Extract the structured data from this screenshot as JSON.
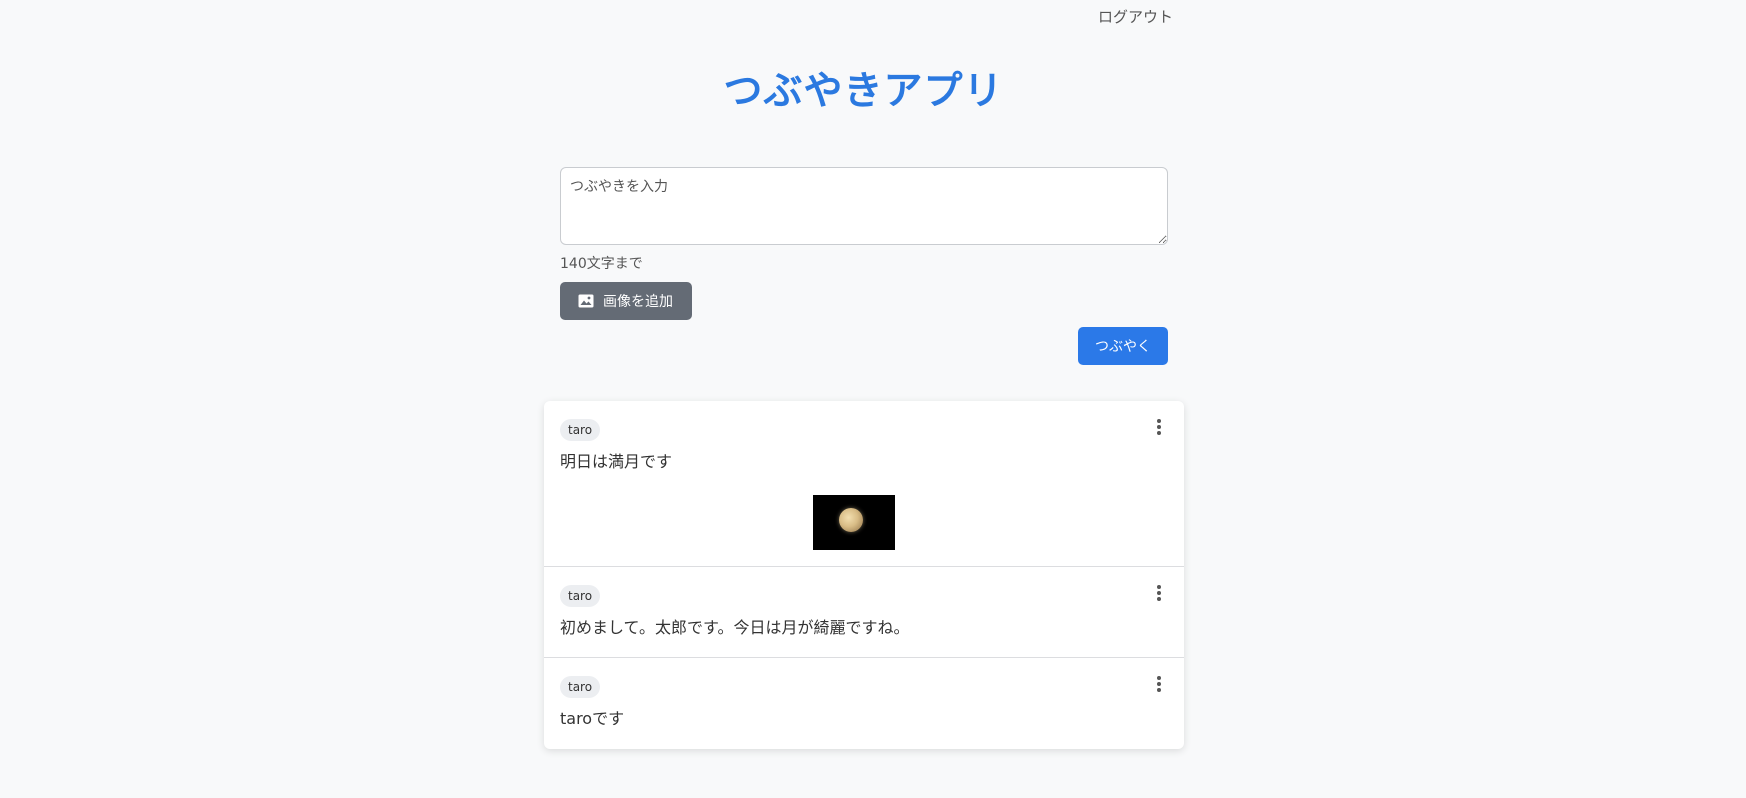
{
  "header": {
    "logout_label": "ログアウト",
    "title": "つぶやきアプリ"
  },
  "composer": {
    "placeholder": "つぶやきを入力",
    "value": "",
    "char_limit_text": "140文字まで",
    "add_image_label": "画像を追加",
    "add_image_icon": "image-icon",
    "submit_label": "つぶやく"
  },
  "colors": {
    "accent": "#2b79e0",
    "secondary_button": "#646b75",
    "background": "#f8f9fa"
  },
  "posts": [
    {
      "user": "taro",
      "text": "明日は満月です",
      "has_image": true,
      "image_subject": "full moon on black background",
      "menu_icon": "more-vertical-icon"
    },
    {
      "user": "taro",
      "text": "初めまして。太郎です。今日は月が綺麗ですね。",
      "has_image": false,
      "menu_icon": "more-vertical-icon"
    },
    {
      "user": "taro",
      "text": "taroです",
      "has_image": false,
      "menu_icon": "more-vertical-icon"
    }
  ]
}
